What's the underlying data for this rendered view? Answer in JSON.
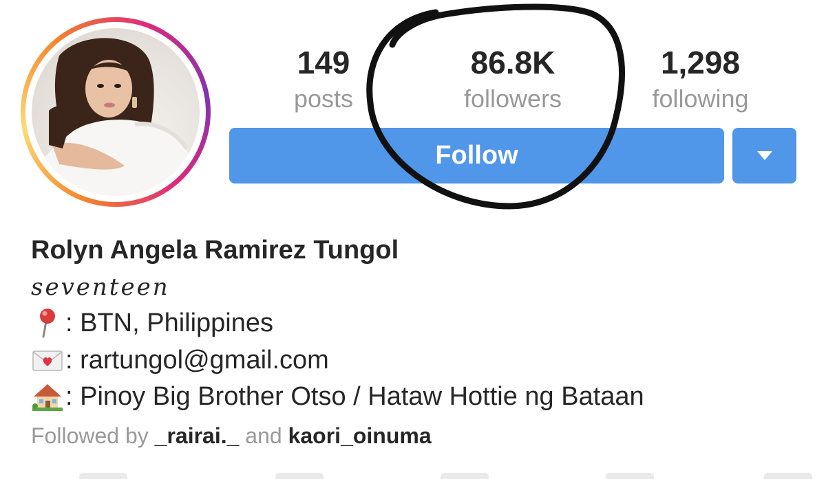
{
  "profile": {
    "stats": {
      "posts": {
        "count": "149",
        "label": "posts"
      },
      "followers": {
        "count": "86.8K",
        "label": "followers"
      },
      "following": {
        "count": "1,298",
        "label": "following"
      }
    },
    "follow_button_label": "Follow",
    "name": "Rolyn Angela Ramirez Tungol",
    "tagline": "seventeen",
    "bio": {
      "location": ": BTN, Philippines",
      "email": ": rartungol@gmail.com",
      "home": ": Pinoy Big Brother Otso / Hataw Hottie ng Bataan"
    },
    "followed_by": {
      "prefix": "Followed by",
      "user1": "_rairai._",
      "conjunction": "and",
      "user2": "kaori_oinuma"
    }
  },
  "icons": {
    "location": "round-pushpin-icon",
    "email": "love-letter-icon",
    "home": "house-with-garden-icon",
    "dropdown": "caret-down-icon"
  },
  "colors": {
    "button_blue": "#5096e9",
    "primary_text": "#262626",
    "secondary_text": "#999999",
    "annotation_ink": "#111111"
  }
}
